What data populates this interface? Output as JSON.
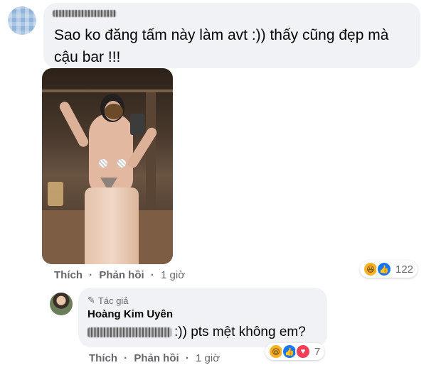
{
  "comment": {
    "author_name_blurred": "",
    "text": "Sao ko đăng tấm này làm avt :)) thấy cũng đẹp mà cậu bar !!!",
    "actions": {
      "like": "Thích",
      "reply": "Phản hồi",
      "time": "1 giờ",
      "separator": "·"
    },
    "reactions": {
      "icons": [
        "haha-icon",
        "like-icon"
      ],
      "count": "122"
    }
  },
  "reply": {
    "badge_label": "Tác giả",
    "author_name": "Hoàng Kim Uyên",
    "tag_blurred": "",
    "text": ":)) pts mệt không em?",
    "actions": {
      "like": "Thích",
      "reply": "Phản hồi",
      "time": "1 giờ",
      "separator": "·"
    },
    "reactions": {
      "icons": [
        "haha-icon",
        "like-icon",
        "love-icon"
      ],
      "count": "7"
    }
  },
  "colors": {
    "bubble_bg": "#f0f2f5",
    "meta_text": "#65676b",
    "like_blue": "#1877f2",
    "love_red": "#f33e58",
    "haha_yellow": "#f7b125"
  }
}
